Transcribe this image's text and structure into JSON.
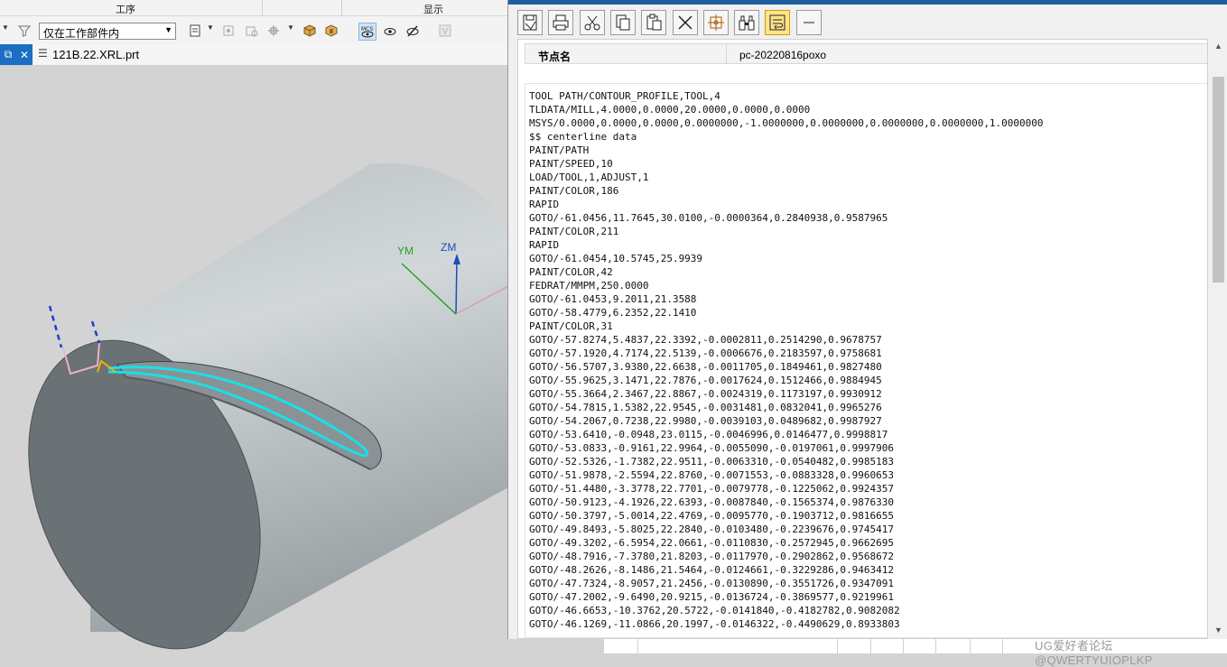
{
  "ribbon": {
    "groups": [
      "工序",
      "显示"
    ]
  },
  "toolbar": {
    "scope_select_value": "仅在工作部件内",
    "icons": [
      "filter-icon",
      "selection-filter-icon",
      "snap-icon",
      "point-snap-icon",
      "box-icon",
      "part-icon",
      "mcs-display-icon",
      "show-icon",
      "hide-icon",
      "disabled-icon"
    ]
  },
  "document_tab": {
    "file_name": "121B.22.XRL.prt"
  },
  "viewport": {
    "axis_labels": {
      "ym": "YM",
      "zm": "ZM"
    },
    "colors": {
      "background": "#d3d3d3",
      "cylinder": "#c3c9cc",
      "end_face": "#6b7275",
      "toolpath": "#19e0e8",
      "axis_y": "#2a9d2a",
      "axis_z": "#1a4fb8",
      "engage": "#f0b400"
    }
  },
  "info_window": {
    "toolbar_icons": [
      "save-icon",
      "print-icon",
      "cut-icon",
      "copy-icon",
      "paste-icon",
      "delete-icon",
      "find-target-icon",
      "binoculars-icon",
      "wrap-icon",
      "minimize-icon"
    ],
    "node_label": "节点名",
    "node_value": "pc-20220816poxo",
    "listing": [
      "TOOL PATH/CONTOUR_PROFILE,TOOL,4",
      "TLDATA/MILL,4.0000,0.0000,20.0000,0.0000,0.0000",
      "MSYS/0.0000,0.0000,0.0000,0.0000000,-1.0000000,0.0000000,0.0000000,0.0000000,1.0000000",
      "$$ centerline data",
      "PAINT/PATH",
      "PAINT/SPEED,10",
      "LOAD/TOOL,1,ADJUST,1",
      "PAINT/COLOR,186",
      "RAPID",
      "GOTO/-61.0456,11.7645,30.0100,-0.0000364,0.2840938,0.9587965",
      "PAINT/COLOR,211",
      "RAPID",
      "GOTO/-61.0454,10.5745,25.9939",
      "PAINT/COLOR,42",
      "FEDRAT/MMPM,250.0000",
      "GOTO/-61.0453,9.2011,21.3588",
      "GOTO/-58.4779,6.2352,22.1410",
      "PAINT/COLOR,31",
      "GOTO/-57.8274,5.4837,22.3392,-0.0002811,0.2514290,0.9678757",
      "GOTO/-57.1920,4.7174,22.5139,-0.0006676,0.2183597,0.9758681",
      "GOTO/-56.5707,3.9380,22.6638,-0.0011705,0.1849461,0.9827480",
      "GOTO/-55.9625,3.1471,22.7876,-0.0017624,0.1512466,0.9884945",
      "GOTO/-55.3664,2.3467,22.8867,-0.0024319,0.1173197,0.9930912",
      "GOTO/-54.7815,1.5382,22.9545,-0.0031481,0.0832041,0.9965276",
      "GOTO/-54.2067,0.7238,22.9980,-0.0039103,0.0489682,0.9987927",
      "GOTO/-53.6410,-0.0948,23.0115,-0.0046996,0.0146477,0.9998817",
      "GOTO/-53.0833,-0.9161,22.9964,-0.0055090,-0.0197061,0.9997906",
      "GOTO/-52.5326,-1.7382,22.9511,-0.0063310,-0.0540482,0.9985183",
      "GOTO/-51.9878,-2.5594,22.8760,-0.0071553,-0.0883328,0.9960653",
      "GOTO/-51.4480,-3.3778,22.7701,-0.0079778,-0.1225062,0.9924357",
      "GOTO/-50.9123,-4.1926,22.6393,-0.0087840,-0.1565374,0.9876330",
      "GOTO/-50.3797,-5.0014,22.4769,-0.0095770,-0.1903712,0.9816655",
      "GOTO/-49.8493,-5.8025,22.2840,-0.0103480,-0.2239676,0.9745417",
      "GOTO/-49.3202,-6.5954,22.0661,-0.0110830,-0.2572945,0.9662695",
      "GOTO/-48.7916,-7.3780,21.8203,-0.0117970,-0.2902862,0.9568672",
      "GOTO/-48.2626,-8.1486,21.5464,-0.0124661,-0.3229286,0.9463412",
      "GOTO/-47.7324,-8.9057,21.2456,-0.0130890,-0.3551726,0.9347091",
      "GOTO/-47.2002,-9.6490,20.9215,-0.0136724,-0.3869577,0.9219961",
      "GOTO/-46.6653,-10.3762,20.5722,-0.0141840,-0.4182782,0.9082082",
      "GOTO/-46.1269,-11.0866,20.1997,-0.0146322,-0.4490629,0.8933803"
    ]
  },
  "watermark": "UG爱好者论坛@QWERTYUIOPLKP"
}
